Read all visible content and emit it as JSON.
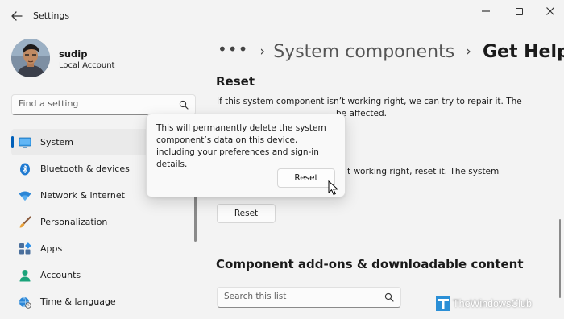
{
  "window": {
    "title": "Settings",
    "back_icon": "back-arrow-icon",
    "controls": [
      "minimize-icon",
      "maximize-icon",
      "close-icon"
    ]
  },
  "user": {
    "name": "sudip",
    "account_type": "Local Account"
  },
  "sidebar": {
    "search_placeholder": "Find a setting",
    "items": [
      {
        "label": "System",
        "icon": "monitor-icon",
        "active": true
      },
      {
        "label": "Bluetooth & devices",
        "icon": "bluetooth-icon",
        "active": false
      },
      {
        "label": "Network & internet",
        "icon": "wifi-icon",
        "active": false
      },
      {
        "label": "Personalization",
        "icon": "brush-icon",
        "active": false
      },
      {
        "label": "Apps",
        "icon": "apps-icon",
        "active": false
      },
      {
        "label": "Accounts",
        "icon": "person-icon",
        "active": false
      },
      {
        "label": "Time & language",
        "icon": "globe-clock-icon",
        "active": false
      }
    ]
  },
  "breadcrumb": {
    "overflow": "•••",
    "parent": "System components",
    "current": "Get Help"
  },
  "main": {
    "reset_section_title": "Reset",
    "repair_desc_line1": "If this system component isn’t working right, we can try to repair it. The",
    "repair_desc_line2": "be affected.",
    "reset_desc_line1": "n’t working right, reset it. The system",
    "reset_desc_line2": "d.",
    "reset_button": "Reset",
    "addons_title": "Component add-ons & downloadable content",
    "list_search_placeholder": "Search this list"
  },
  "flyout": {
    "message": "This will permanently delete the system component’s data on this device, including your preferences and sign-in details.",
    "confirm_button": "Reset"
  },
  "watermark": {
    "text": "TheWindowsClub"
  },
  "colors": {
    "accent": "#005fb8",
    "background": "#f3f3f3",
    "flyout_bg": "#f9f9f9"
  }
}
